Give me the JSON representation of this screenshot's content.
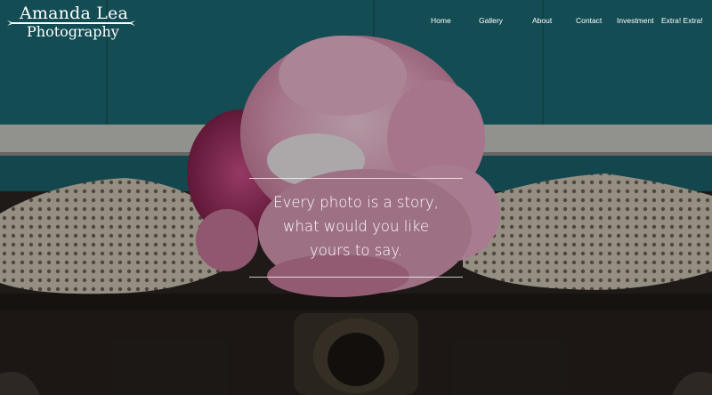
{
  "brand": {
    "line1": "Amanda Lea",
    "line2": "Photography"
  },
  "nav": {
    "items": [
      {
        "label": "Home"
      },
      {
        "label": "Gallery"
      },
      {
        "label": "About"
      },
      {
        "label": "Contact"
      },
      {
        "label": "Investment"
      },
      {
        "label": "Extra! Extra!"
      }
    ]
  },
  "hero": {
    "tagline": {
      "line1": "Every photo is a story,",
      "line2": "what would you like",
      "line3": "yours to say."
    },
    "colors": {
      "wall": "#1d6a73",
      "trim": "#c8c9c4",
      "chest": "#2a2420",
      "doily": "#d9d2c2",
      "peony": "#e9a9c6",
      "sweet_william": "#b33670"
    }
  }
}
